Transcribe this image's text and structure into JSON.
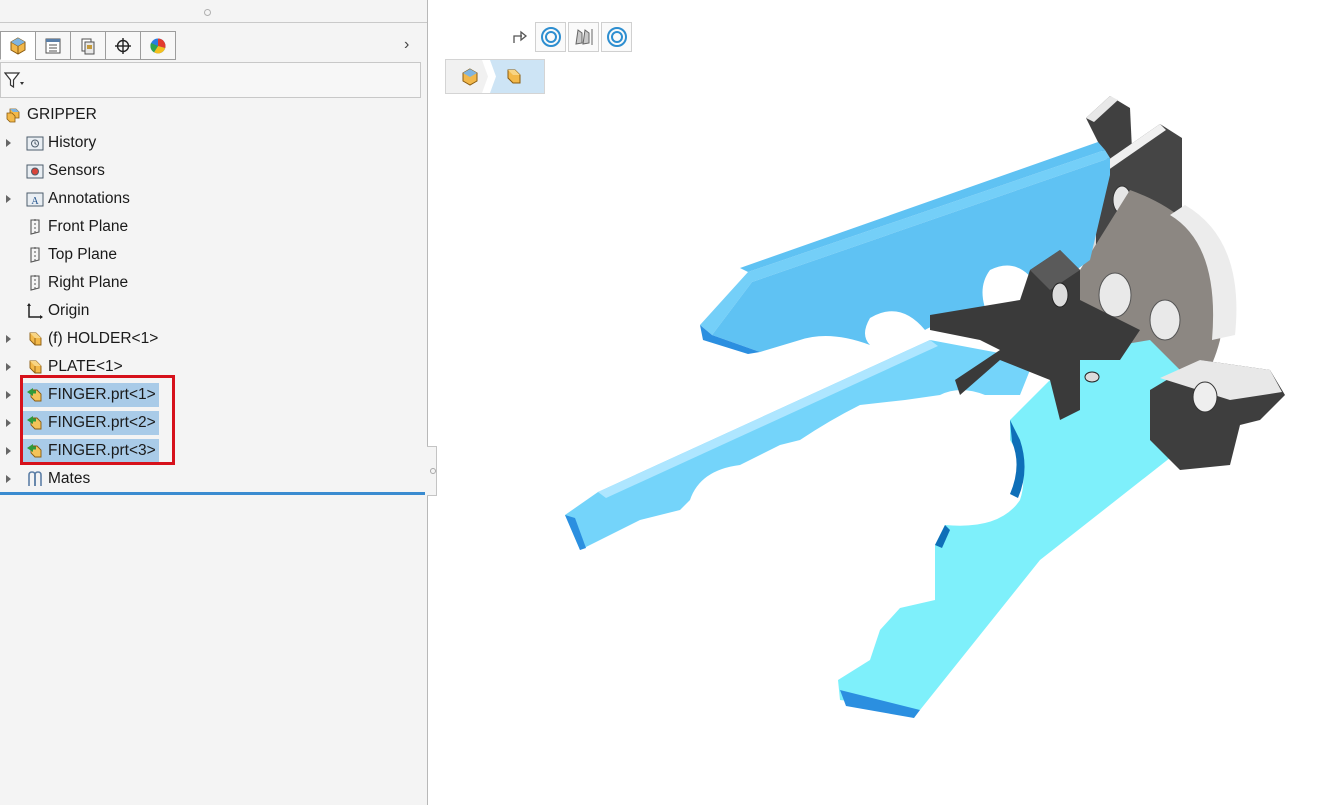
{
  "feature_tree": {
    "tabs": [
      {
        "icon": "feature-manager-icon",
        "active": true
      },
      {
        "icon": "property-manager-icon",
        "active": false
      },
      {
        "icon": "configuration-manager-icon",
        "active": false
      },
      {
        "icon": "dimxpert-manager-icon",
        "active": false
      },
      {
        "icon": "display-manager-icon",
        "active": false
      }
    ],
    "filter_icon": "filter-icon",
    "root": {
      "label": "GRIPPER",
      "icon": "assembly-icon"
    },
    "items": [
      {
        "label": "History",
        "icon": "history-folder-icon",
        "expandable": true,
        "selected": false
      },
      {
        "label": "Sensors",
        "icon": "sensors-folder-icon",
        "expandable": false,
        "selected": false
      },
      {
        "label": "Annotations",
        "icon": "annotations-folder-icon",
        "expandable": true,
        "selected": false
      },
      {
        "label": "Front Plane",
        "icon": "plane-icon",
        "expandable": false,
        "selected": false
      },
      {
        "label": "Top Plane",
        "icon": "plane-icon",
        "expandable": false,
        "selected": false
      },
      {
        "label": "Right Plane",
        "icon": "plane-icon",
        "expandable": false,
        "selected": false
      },
      {
        "label": "Origin",
        "icon": "origin-icon",
        "expandable": false,
        "selected": false
      },
      {
        "label": "(f) HOLDER<1>",
        "icon": "part-icon",
        "expandable": true,
        "selected": false
      },
      {
        "label": "PLATE<1>",
        "icon": "part-icon",
        "expandable": true,
        "selected": false
      },
      {
        "label": "FINGER.prt<1>",
        "icon": "virtual-part-icon",
        "expandable": true,
        "selected": true
      },
      {
        "label": "FINGER.prt<2>",
        "icon": "virtual-part-icon",
        "expandable": true,
        "selected": true
      },
      {
        "label": "FINGER.prt<3>",
        "icon": "virtual-part-icon",
        "expandable": true,
        "selected": true
      },
      {
        "label": "Mates",
        "icon": "mates-icon",
        "expandable": true,
        "selected": false
      }
    ]
  },
  "viewport": {
    "toolbar_icons": [
      "forward-arrow-icon",
      "display-style-icon",
      "section-view-icon",
      "view-settings-icon"
    ],
    "breadcrumb_icons": [
      "assembly-icon",
      "part-icon"
    ],
    "model": "gripper-assembly",
    "colors": {
      "selected_part": "#5ec8f5",
      "part_edge": "#0d4f86",
      "holder": "#3d3d3d",
      "plate": "#8c8c8c"
    }
  }
}
